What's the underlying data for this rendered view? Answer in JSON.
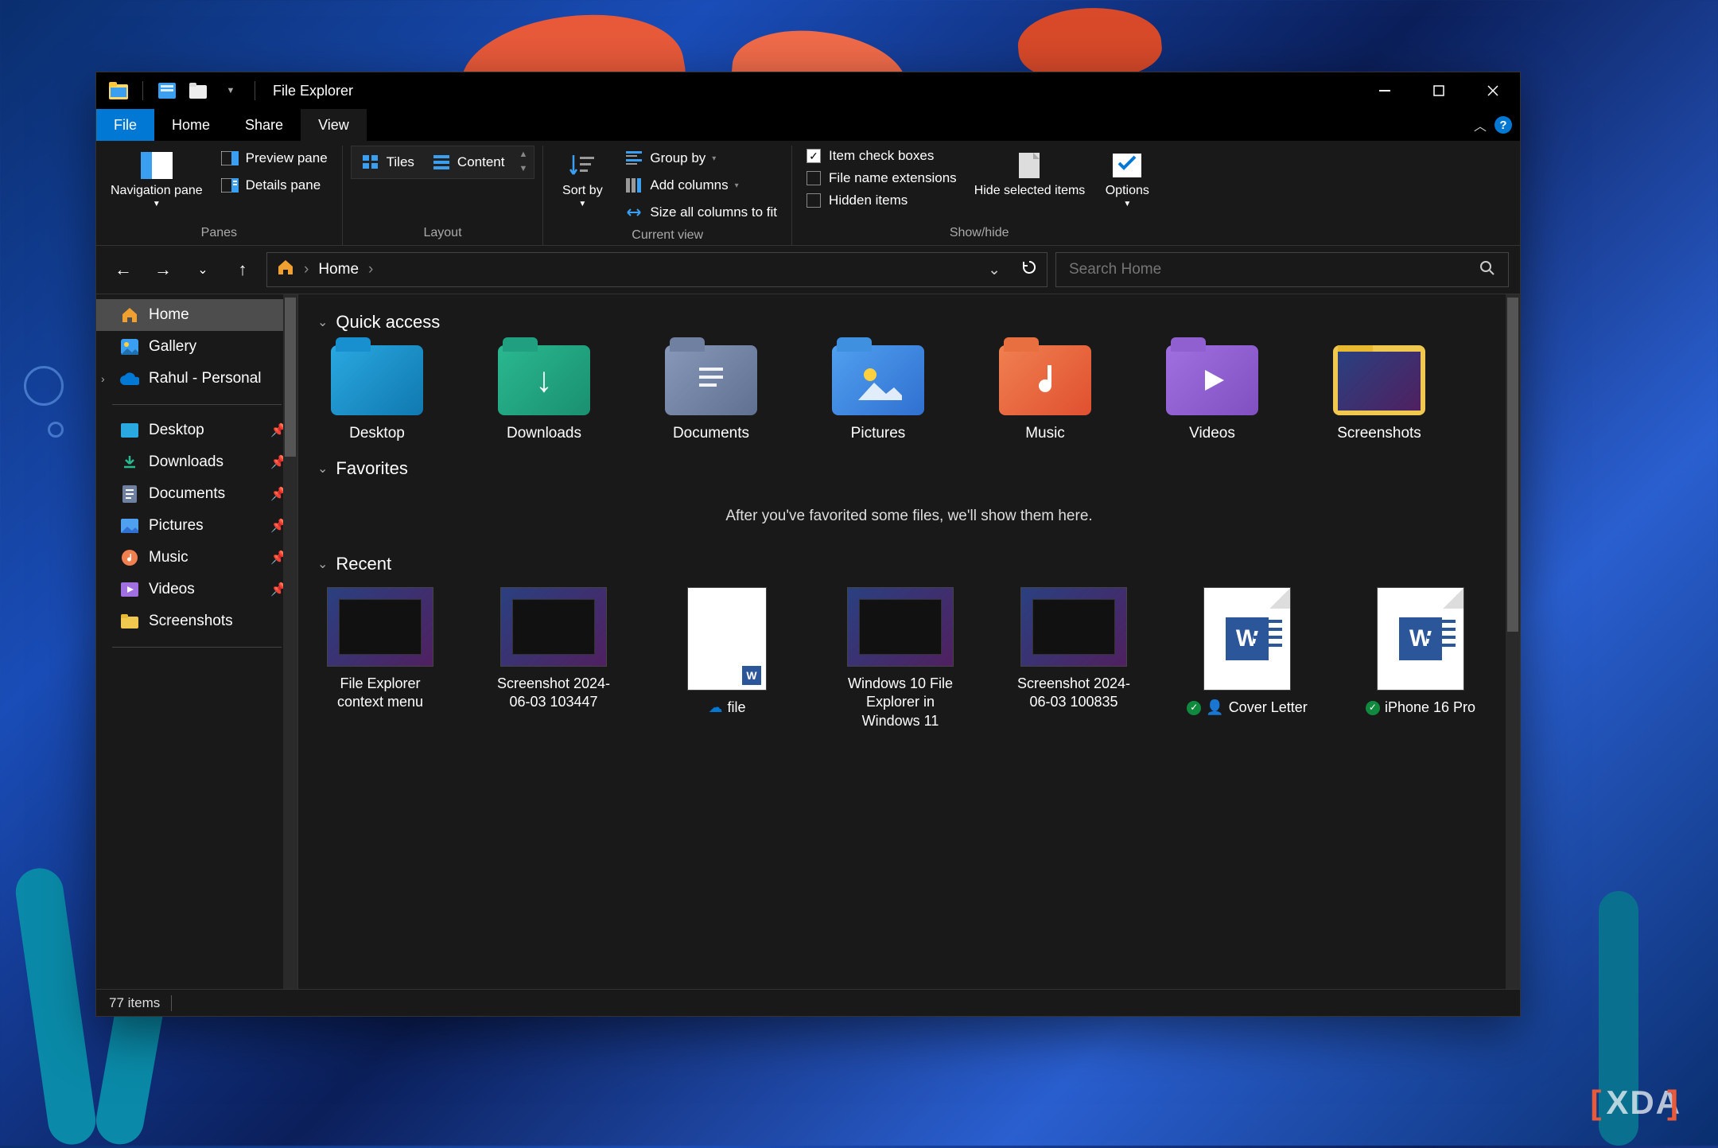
{
  "window_title": "File Explorer",
  "menus": {
    "file": "File",
    "home": "Home",
    "share": "Share",
    "view": "View"
  },
  "ribbon": {
    "panes": {
      "nav": "Navigation pane",
      "preview": "Preview pane",
      "details": "Details pane",
      "group": "Panes"
    },
    "layout": {
      "tiles": "Tiles",
      "content": "Content",
      "group": "Layout"
    },
    "current": {
      "sortby": "Sort by",
      "groupby": "Group by",
      "addcols": "Add columns",
      "sizeall": "Size all columns to fit",
      "group": "Current view"
    },
    "showhide": {
      "checkboxes": "Item check boxes",
      "ext": "File name extensions",
      "hidden": "Hidden items",
      "hidesel": "Hide selected items",
      "options": "Options",
      "group": "Show/hide"
    }
  },
  "breadcrumb": {
    "root": "Home"
  },
  "search_placeholder": "Search Home",
  "sidebar": {
    "home": "Home",
    "gallery": "Gallery",
    "onedrive": "Rahul - Personal",
    "desktop": "Desktop",
    "downloads": "Downloads",
    "documents": "Documents",
    "pictures": "Pictures",
    "music": "Music",
    "videos": "Videos",
    "screenshots": "Screenshots"
  },
  "sections": {
    "quick": "Quick access",
    "favorites": "Favorites",
    "recent": "Recent"
  },
  "favorites_empty": "After you've favorited some files, we'll show them here.",
  "quick_access": [
    {
      "label": "Desktop"
    },
    {
      "label": "Downloads"
    },
    {
      "label": "Documents"
    },
    {
      "label": "Pictures"
    },
    {
      "label": "Music"
    },
    {
      "label": "Videos"
    },
    {
      "label": "Screenshots"
    }
  ],
  "recent": [
    {
      "label": "File Explorer context menu"
    },
    {
      "label": "Screenshot 2024-06-03 103447"
    },
    {
      "label": "file"
    },
    {
      "label": "Windows 10 File Explorer in Windows 11"
    },
    {
      "label": "Screenshot 2024-06-03 100835"
    },
    {
      "label": "Cover Letter"
    },
    {
      "label": "iPhone 16 Pro"
    }
  ],
  "status": {
    "count": "77 items"
  },
  "watermark": "XDA"
}
